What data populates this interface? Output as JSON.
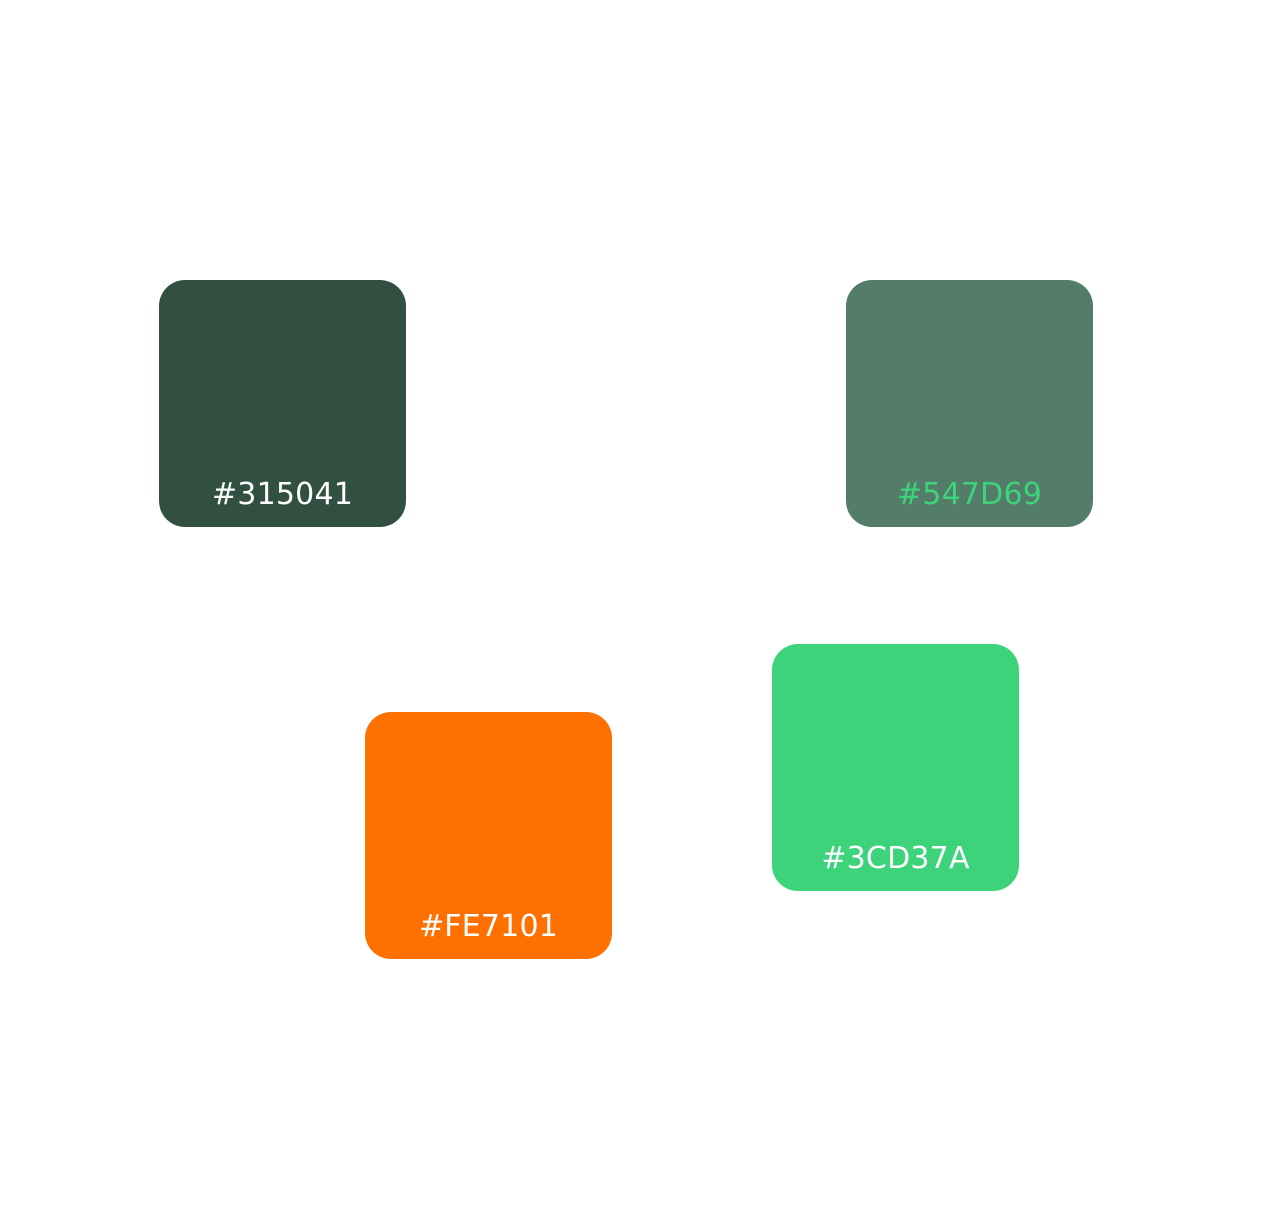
{
  "swatches": [
    {
      "hex": "#315041",
      "color": "#315041",
      "label_color": "#ffffff"
    },
    {
      "hex": "#547D69",
      "color": "#547D69",
      "label_color": "#3CD37A"
    },
    {
      "hex": "#FE7101",
      "color": "#FE7101",
      "label_color": "#ffffff"
    },
    {
      "hex": "#3CD37A",
      "color": "#3CD37A",
      "label_color": "#ffffff"
    }
  ]
}
